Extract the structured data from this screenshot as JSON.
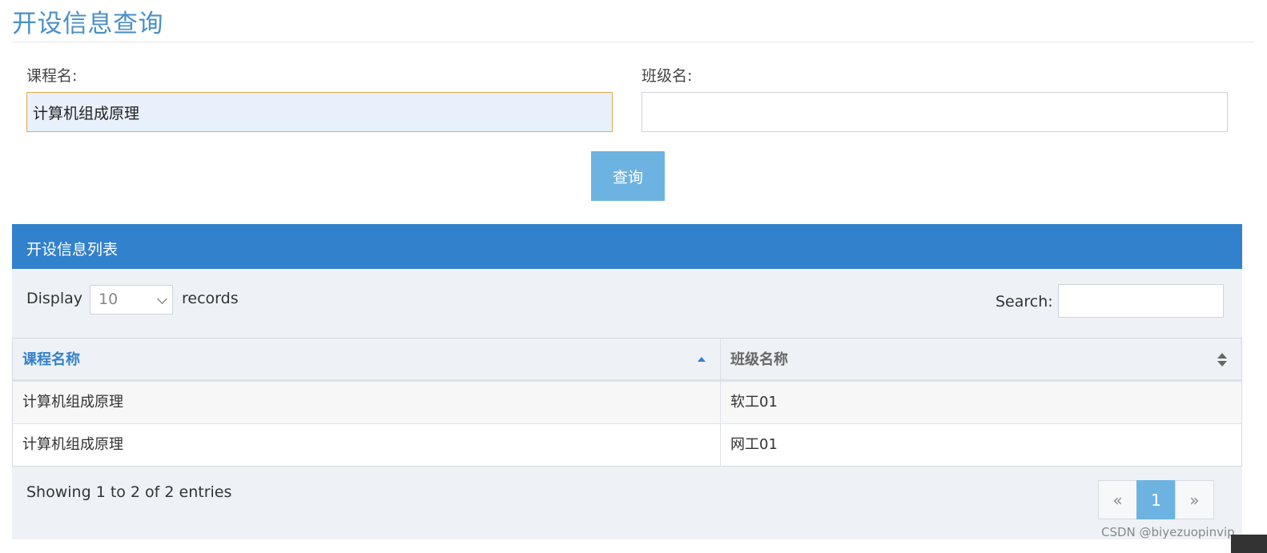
{
  "page": {
    "title": "开设信息查询"
  },
  "form": {
    "course_label": "课程名:",
    "course_value": "计算机组成原理",
    "class_label": "班级名:",
    "class_value": "",
    "query_button": "查询"
  },
  "panel": {
    "title": "开设信息列表",
    "length": {
      "prefix": "Display",
      "selected": "10",
      "suffix": "records"
    },
    "search_label": "Search:",
    "table": {
      "headers": [
        "课程名称",
        "班级名称"
      ],
      "rows": [
        [
          "计算机组成原理",
          "软工01"
        ],
        [
          "计算机组成原理",
          "网工01"
        ]
      ]
    },
    "info": "Showing 1 to 2 of 2 entries",
    "pagination": {
      "prev": "«",
      "current": "1",
      "next": "»"
    }
  },
  "watermark": "CSDN @biyezuopinvip",
  "colors": {
    "accent": "#3281cc",
    "button": "#6cb3e2",
    "title": "#4a90c8"
  }
}
